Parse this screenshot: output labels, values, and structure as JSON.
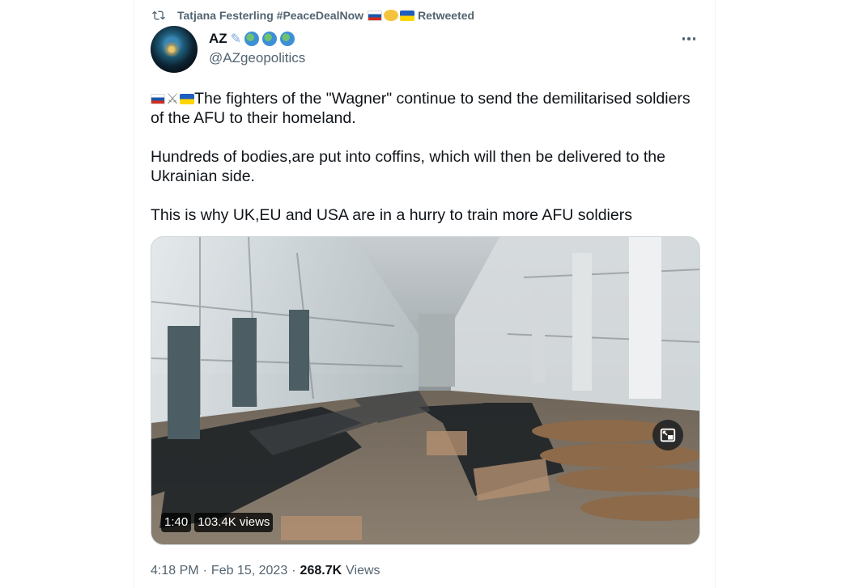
{
  "retweet_banner": {
    "retweeter": "Tatjana Festerling #PeaceDealNow",
    "label": "Retweeted"
  },
  "author": {
    "display_name": "AZ",
    "handle": "@AZgeopolitics"
  },
  "tweet": {
    "paragraphs": [
      "The fighters of the \"Wagner\" continue to send the demilitarised soldiers of the AFU to their homeland.",
      "Hundreds of bodies,are put into coffins, which will then be delivered to the Ukrainian side.",
      "This is why UK,EU and USA are in a hurry to train more AFU soldiers"
    ]
  },
  "media": {
    "duration": "1:40",
    "views": "103.4K views"
  },
  "footer": {
    "time": "4:18 PM",
    "date": "Feb 15, 2023",
    "views_count": "268.7K",
    "views_label": "Views"
  },
  "colors": {
    "secondary_text": "#536471",
    "primary_text": "#0f1419",
    "border": "#eff3f4"
  }
}
